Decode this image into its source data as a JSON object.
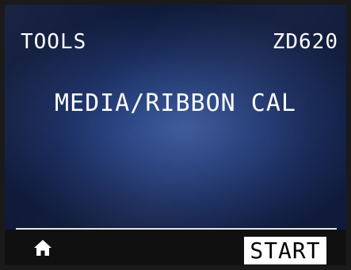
{
  "header": {
    "menu_title": "TOOLS",
    "model": "ZD620"
  },
  "main": {
    "message": "MEDIA/RIBBON CAL"
  },
  "footer": {
    "home_icon": "home-icon",
    "start_label": "START"
  },
  "colors": {
    "screen_center": "#3c5a9c",
    "screen_edge": "#101b3c",
    "text": "#ffffff",
    "footer_bg": "#101010",
    "start_button_bg": "#ffffff",
    "start_button_text": "#000000"
  }
}
